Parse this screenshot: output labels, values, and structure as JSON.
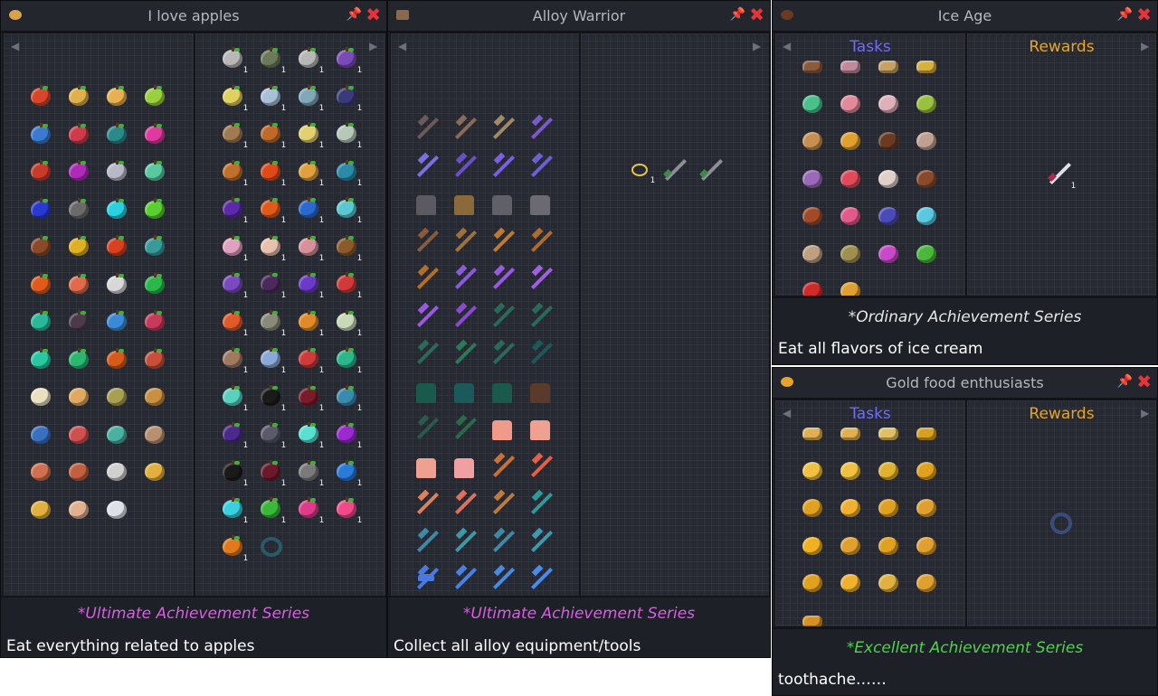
{
  "colors": {
    "ultimate": "#d65fe0",
    "ordinary": "#e6e6e6",
    "excellent": "#4ed44a",
    "tasks": "#6f6ef0",
    "rewards": "#e6a52a",
    "close": "#e8333a"
  },
  "windows": {
    "apples": {
      "title": "I love apples",
      "series": "*Ultimate Achievement Series",
      "desc": "Eat everything related to apples",
      "count": "1"
    },
    "alloy": {
      "title": "Alloy Warrior",
      "series": "*Ultimate Achievement Series",
      "desc": "Collect all alloy equipment/tools",
      "count": "1"
    },
    "iceage": {
      "title": "Ice Age",
      "tasks": "Tasks",
      "rewards": "Rewards",
      "series": "*Ordinary Achievement Series",
      "desc": "Eat all flavors of ice cream",
      "count": "1"
    },
    "gold": {
      "title": "Gold food enthusiasts",
      "tasks": "Tasks",
      "rewards": "Rewards",
      "series": "*Excellent Achievement Series",
      "desc": "toothache……"
    }
  },
  "icons": {
    "pin": "pin-icon",
    "close": "close-icon",
    "scroll_left": "chevron-left-icon",
    "scroll_right": "chevron-right-icon"
  },
  "glyphs": {
    "pin": "📌",
    "close": "✖",
    "left": "◀",
    "right": "▶"
  }
}
